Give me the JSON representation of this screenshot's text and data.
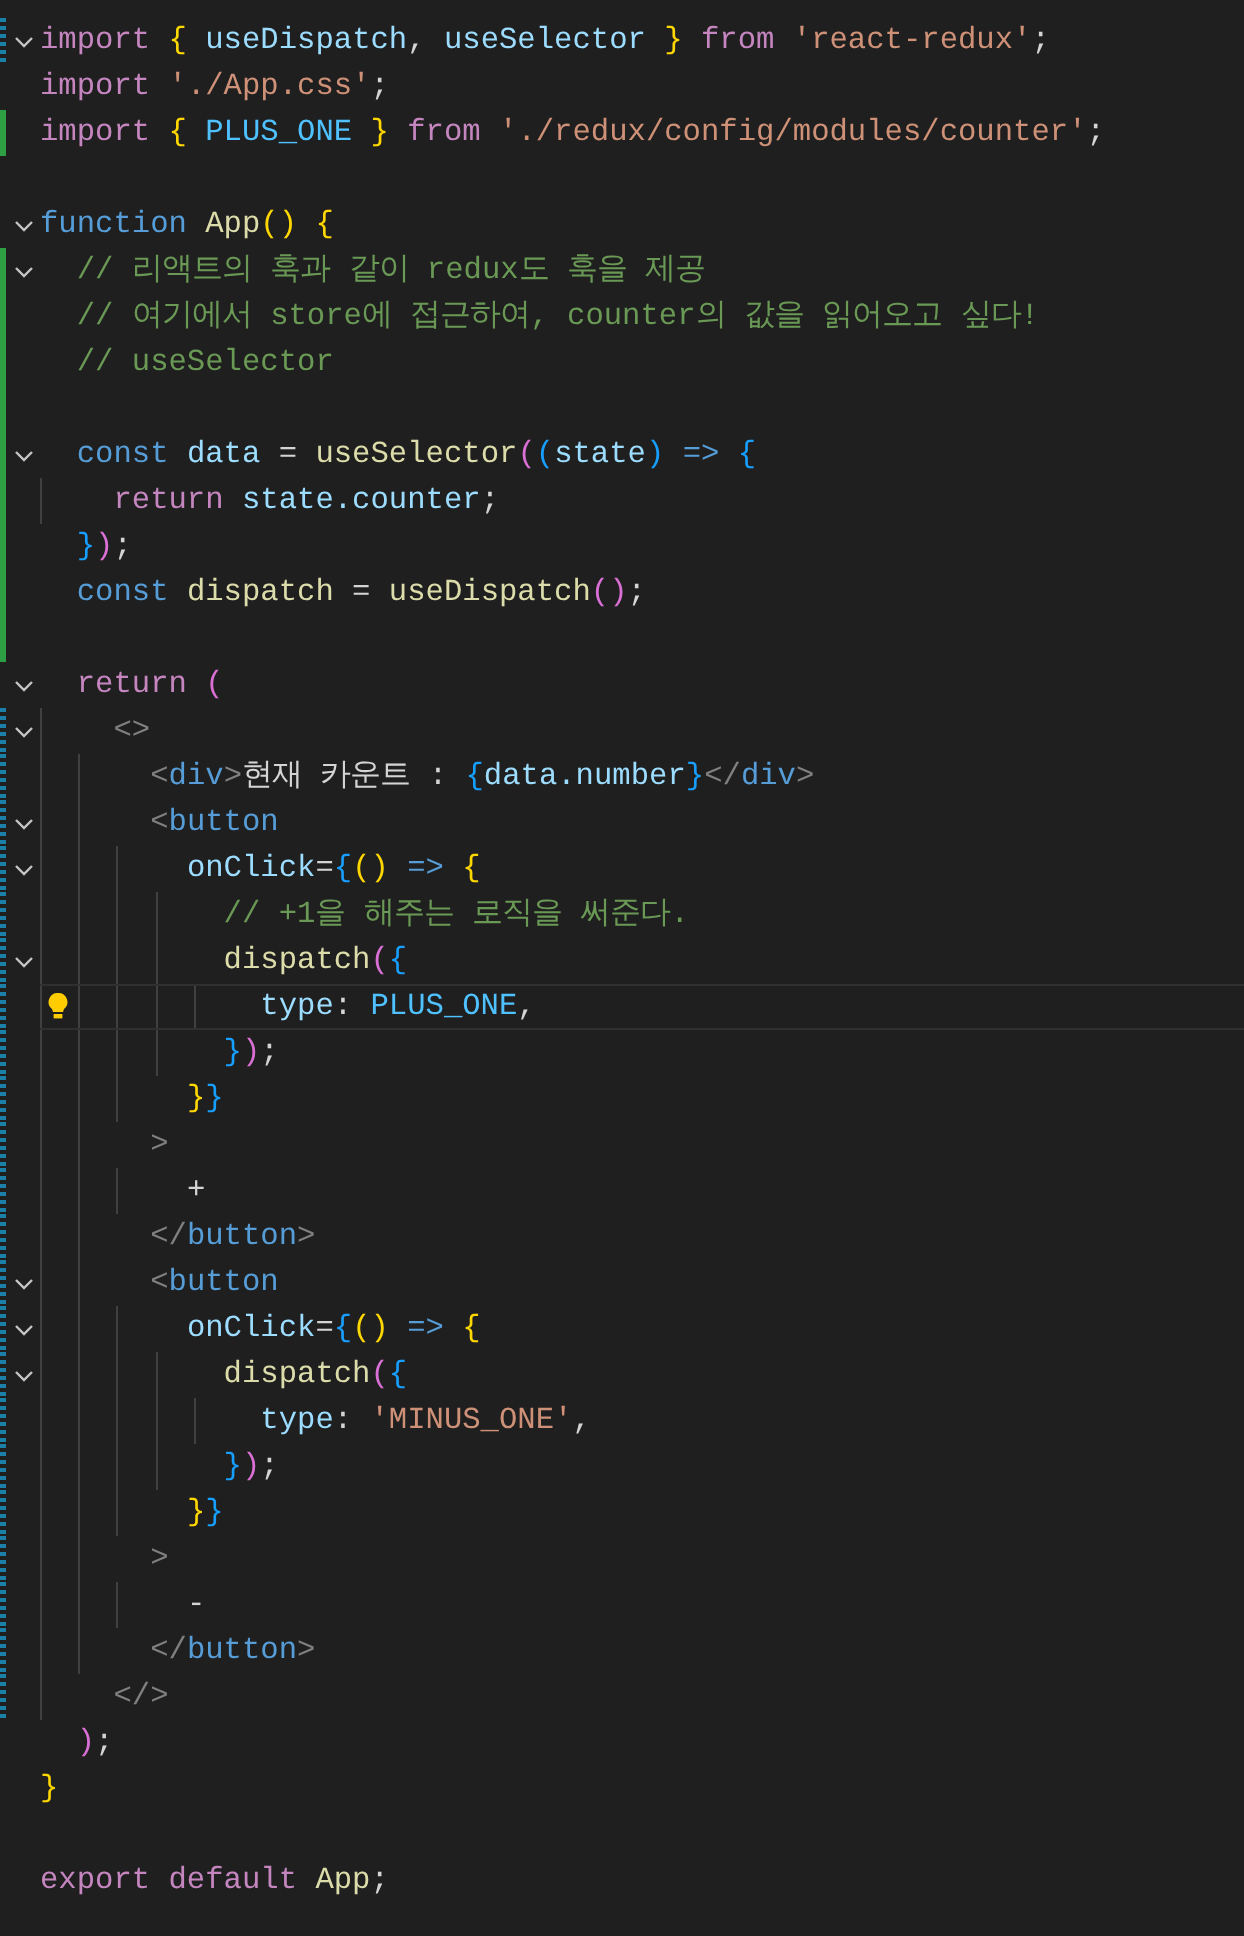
{
  "editor": {
    "lines": [
      {
        "fold": true,
        "added": false,
        "modified": true,
        "tokens": [
          {
            "kind": "kw",
            "text": "import "
          },
          {
            "kind": "b1",
            "text": "{"
          },
          {
            "kind": "var",
            "text": " useDispatch"
          },
          {
            "kind": "p",
            "text": ", "
          },
          {
            "kind": "var",
            "text": "useSelector "
          },
          {
            "kind": "b1",
            "text": "}"
          },
          {
            "kind": "kw",
            "text": " from "
          },
          {
            "kind": "str",
            "text": "'react-redux'"
          },
          {
            "kind": "p",
            "text": ";"
          }
        ]
      },
      {
        "added": false,
        "modified": false,
        "tokens": [
          {
            "kind": "kw",
            "text": "import "
          },
          {
            "kind": "str",
            "text": "'./App.css'"
          },
          {
            "kind": "p",
            "text": ";"
          }
        ]
      },
      {
        "added": true,
        "modified": false,
        "tokens": [
          {
            "kind": "kw",
            "text": "import "
          },
          {
            "kind": "b1",
            "text": "{"
          },
          {
            "kind": "cst",
            "text": " PLUS_ONE "
          },
          {
            "kind": "b1",
            "text": "}"
          },
          {
            "kind": "kw",
            "text": " from "
          },
          {
            "kind": "str",
            "text": "'./redux/config/modules/counter'"
          },
          {
            "kind": "p",
            "text": ";"
          }
        ]
      },
      {
        "added": false,
        "modified": false
      },
      {
        "fold": true,
        "added": false,
        "modified": false,
        "tokens": [
          {
            "kind": "st",
            "text": "function "
          },
          {
            "kind": "fn",
            "text": "App"
          },
          {
            "kind": "b1",
            "text": "() {"
          }
        ]
      },
      {
        "fold": true,
        "added": true,
        "modified": false,
        "tokens": [
          {
            "kind": "cm",
            "text": "  // 리액트의 훅과 같이 redux도 훅을 제공"
          }
        ]
      },
      {
        "added": true,
        "modified": false,
        "tokens": [
          {
            "kind": "cm",
            "text": "  // 여기에서 store에 접근하여, counter의 값을 읽어오고 싶다!"
          }
        ]
      },
      {
        "added": true,
        "modified": false,
        "tokens": [
          {
            "kind": "cm",
            "text": "  // useSelector"
          }
        ]
      },
      {
        "added": true,
        "modified": false
      },
      {
        "fold": true,
        "added": true,
        "modified": false,
        "tokens": [
          {
            "kind": "st",
            "text": "  const "
          },
          {
            "kind": "var",
            "text": "data"
          },
          {
            "kind": "p",
            "text": " = "
          },
          {
            "kind": "fn",
            "text": "useSelector"
          },
          {
            "kind": "b2",
            "text": "("
          },
          {
            "kind": "b3",
            "text": "("
          },
          {
            "kind": "var",
            "text": "state"
          },
          {
            "kind": "b3",
            "text": ")"
          },
          {
            "kind": "st",
            "text": " => "
          },
          {
            "kind": "b3",
            "text": "{"
          }
        ]
      },
      {
        "added": true,
        "modified": false,
        "tokens": [
          {
            "kind": "kw",
            "text": "    return "
          },
          {
            "kind": "var",
            "text": "state.counter"
          },
          {
            "kind": "p",
            "text": ";"
          }
        ]
      },
      {
        "added": true,
        "modified": false,
        "tokens": [
          {
            "kind": "b3",
            "text": "  }"
          },
          {
            "kind": "b2",
            "text": ")"
          },
          {
            "kind": "p",
            "text": ";"
          }
        ]
      },
      {
        "added": true,
        "modified": false,
        "tokens": [
          {
            "kind": "st",
            "text": "  const "
          },
          {
            "kind": "fn",
            "text": "dispatch"
          },
          {
            "kind": "p",
            "text": " = "
          },
          {
            "kind": "fn",
            "text": "useDispatch"
          },
          {
            "kind": "b2",
            "text": "()"
          },
          {
            "kind": "p",
            "text": ";"
          }
        ]
      },
      {
        "added": true,
        "modified": false
      },
      {
        "fold": true,
        "added": false,
        "modified": false,
        "tokens": [
          {
            "kind": "kw",
            "text": "  return "
          },
          {
            "kind": "b2",
            "text": "("
          }
        ]
      },
      {
        "fold": true,
        "added": false,
        "modified": true,
        "tokens": [
          {
            "kind": "tp",
            "text": "    <>"
          }
        ]
      },
      {
        "added": false,
        "modified": true,
        "tokens": [
          {
            "kind": "tp",
            "text": "      <"
          },
          {
            "kind": "tag",
            "text": "div"
          },
          {
            "kind": "tp",
            "text": ">"
          },
          {
            "kind": "p",
            "text": "현재 카운트 : "
          },
          {
            "kind": "b3",
            "text": "{"
          },
          {
            "kind": "var",
            "text": "data.number"
          },
          {
            "kind": "b3",
            "text": "}"
          },
          {
            "kind": "tp",
            "text": "</"
          },
          {
            "kind": "tag",
            "text": "div"
          },
          {
            "kind": "tp",
            "text": ">"
          }
        ]
      },
      {
        "fold": true,
        "added": false,
        "modified": true,
        "tokens": [
          {
            "kind": "tp",
            "text": "      <"
          },
          {
            "kind": "tag",
            "text": "button"
          }
        ]
      },
      {
        "fold": true,
        "added": false,
        "modified": true,
        "tokens": [
          {
            "kind": "var",
            "text": "        onClick"
          },
          {
            "kind": "p",
            "text": "="
          },
          {
            "kind": "b3",
            "text": "{"
          },
          {
            "kind": "b1",
            "text": "()"
          },
          {
            "kind": "st",
            "text": " => "
          },
          {
            "kind": "b1",
            "text": "{"
          }
        ]
      },
      {
        "added": false,
        "modified": true,
        "tokens": [
          {
            "kind": "cm",
            "text": "          // +1을 해주는 로직을 써준다."
          }
        ]
      },
      {
        "fold": true,
        "added": false,
        "modified": true,
        "tokens": [
          {
            "kind": "fn",
            "text": "          dispatch"
          },
          {
            "kind": "b2",
            "text": "("
          },
          {
            "kind": "b3",
            "text": "{"
          }
        ]
      },
      {
        "added": false,
        "modified": true,
        "current": true,
        "lightbulb": true,
        "tokens": [
          {
            "kind": "var",
            "text": "            type"
          },
          {
            "kind": "p",
            "text": ": "
          },
          {
            "kind": "cst",
            "text": "PLUS_ONE"
          },
          {
            "kind": "p",
            "text": ","
          }
        ]
      },
      {
        "added": false,
        "modified": true,
        "tokens": [
          {
            "kind": "b3",
            "text": "          }"
          },
          {
            "kind": "b2",
            "text": ")"
          },
          {
            "kind": "p",
            "text": ";"
          }
        ]
      },
      {
        "added": false,
        "modified": true,
        "tokens": [
          {
            "kind": "b1",
            "text": "        }"
          },
          {
            "kind": "b3",
            "text": "}"
          }
        ]
      },
      {
        "added": false,
        "modified": true,
        "tokens": [
          {
            "kind": "tp",
            "text": "      >"
          }
        ]
      },
      {
        "added": false,
        "modified": true,
        "tokens": [
          {
            "kind": "p",
            "text": "        +"
          }
        ]
      },
      {
        "added": false,
        "modified": true,
        "tokens": [
          {
            "kind": "tp",
            "text": "      </"
          },
          {
            "kind": "tag",
            "text": "button"
          },
          {
            "kind": "tp",
            "text": ">"
          }
        ]
      },
      {
        "fold": true,
        "added": false,
        "modified": true,
        "tokens": [
          {
            "kind": "tp",
            "text": "      <"
          },
          {
            "kind": "tag",
            "text": "button"
          }
        ]
      },
      {
        "fold": true,
        "added": false,
        "modified": true,
        "tokens": [
          {
            "kind": "var",
            "text": "        onClick"
          },
          {
            "kind": "p",
            "text": "="
          },
          {
            "kind": "b3",
            "text": "{"
          },
          {
            "kind": "b1",
            "text": "()"
          },
          {
            "kind": "st",
            "text": " => "
          },
          {
            "kind": "b1",
            "text": "{"
          }
        ]
      },
      {
        "fold": true,
        "added": false,
        "modified": true,
        "tokens": [
          {
            "kind": "fn",
            "text": "          dispatch"
          },
          {
            "kind": "b2",
            "text": "("
          },
          {
            "kind": "b3",
            "text": "{"
          }
        ]
      },
      {
        "added": false,
        "modified": true,
        "tokens": [
          {
            "kind": "var",
            "text": "            type"
          },
          {
            "kind": "p",
            "text": ": "
          },
          {
            "kind": "str",
            "text": "'MINUS_ONE'"
          },
          {
            "kind": "p",
            "text": ","
          }
        ]
      },
      {
        "added": false,
        "modified": true,
        "tokens": [
          {
            "kind": "b3",
            "text": "          }"
          },
          {
            "kind": "b2",
            "text": ")"
          },
          {
            "kind": "p",
            "text": ";"
          }
        ]
      },
      {
        "added": false,
        "modified": true,
        "tokens": [
          {
            "kind": "b1",
            "text": "        }"
          },
          {
            "kind": "b3",
            "text": "}"
          }
        ]
      },
      {
        "added": false,
        "modified": true,
        "tokens": [
          {
            "kind": "tp",
            "text": "      >"
          }
        ]
      },
      {
        "added": false,
        "modified": true,
        "tokens": [
          {
            "kind": "p",
            "text": "        -"
          }
        ]
      },
      {
        "added": false,
        "modified": true,
        "tokens": [
          {
            "kind": "tp",
            "text": "      </"
          },
          {
            "kind": "tag",
            "text": "button"
          },
          {
            "kind": "tp",
            "text": ">"
          }
        ]
      },
      {
        "added": false,
        "modified": true,
        "tokens": [
          {
            "kind": "tp",
            "text": "    </>"
          }
        ]
      },
      {
        "added": false,
        "modified": false,
        "tokens": [
          {
            "kind": "b2",
            "text": "  )"
          },
          {
            "kind": "p",
            "text": ";"
          }
        ]
      },
      {
        "added": false,
        "modified": false,
        "tokens": [
          {
            "kind": "b1",
            "text": "}"
          }
        ]
      },
      {
        "added": false,
        "modified": false
      },
      {
        "added": false,
        "modified": false,
        "tokens": [
          {
            "kind": "kw",
            "text": "export default "
          },
          {
            "kind": "fn",
            "text": "App"
          },
          {
            "kind": "p",
            "text": ";"
          }
        ]
      }
    ]
  }
}
